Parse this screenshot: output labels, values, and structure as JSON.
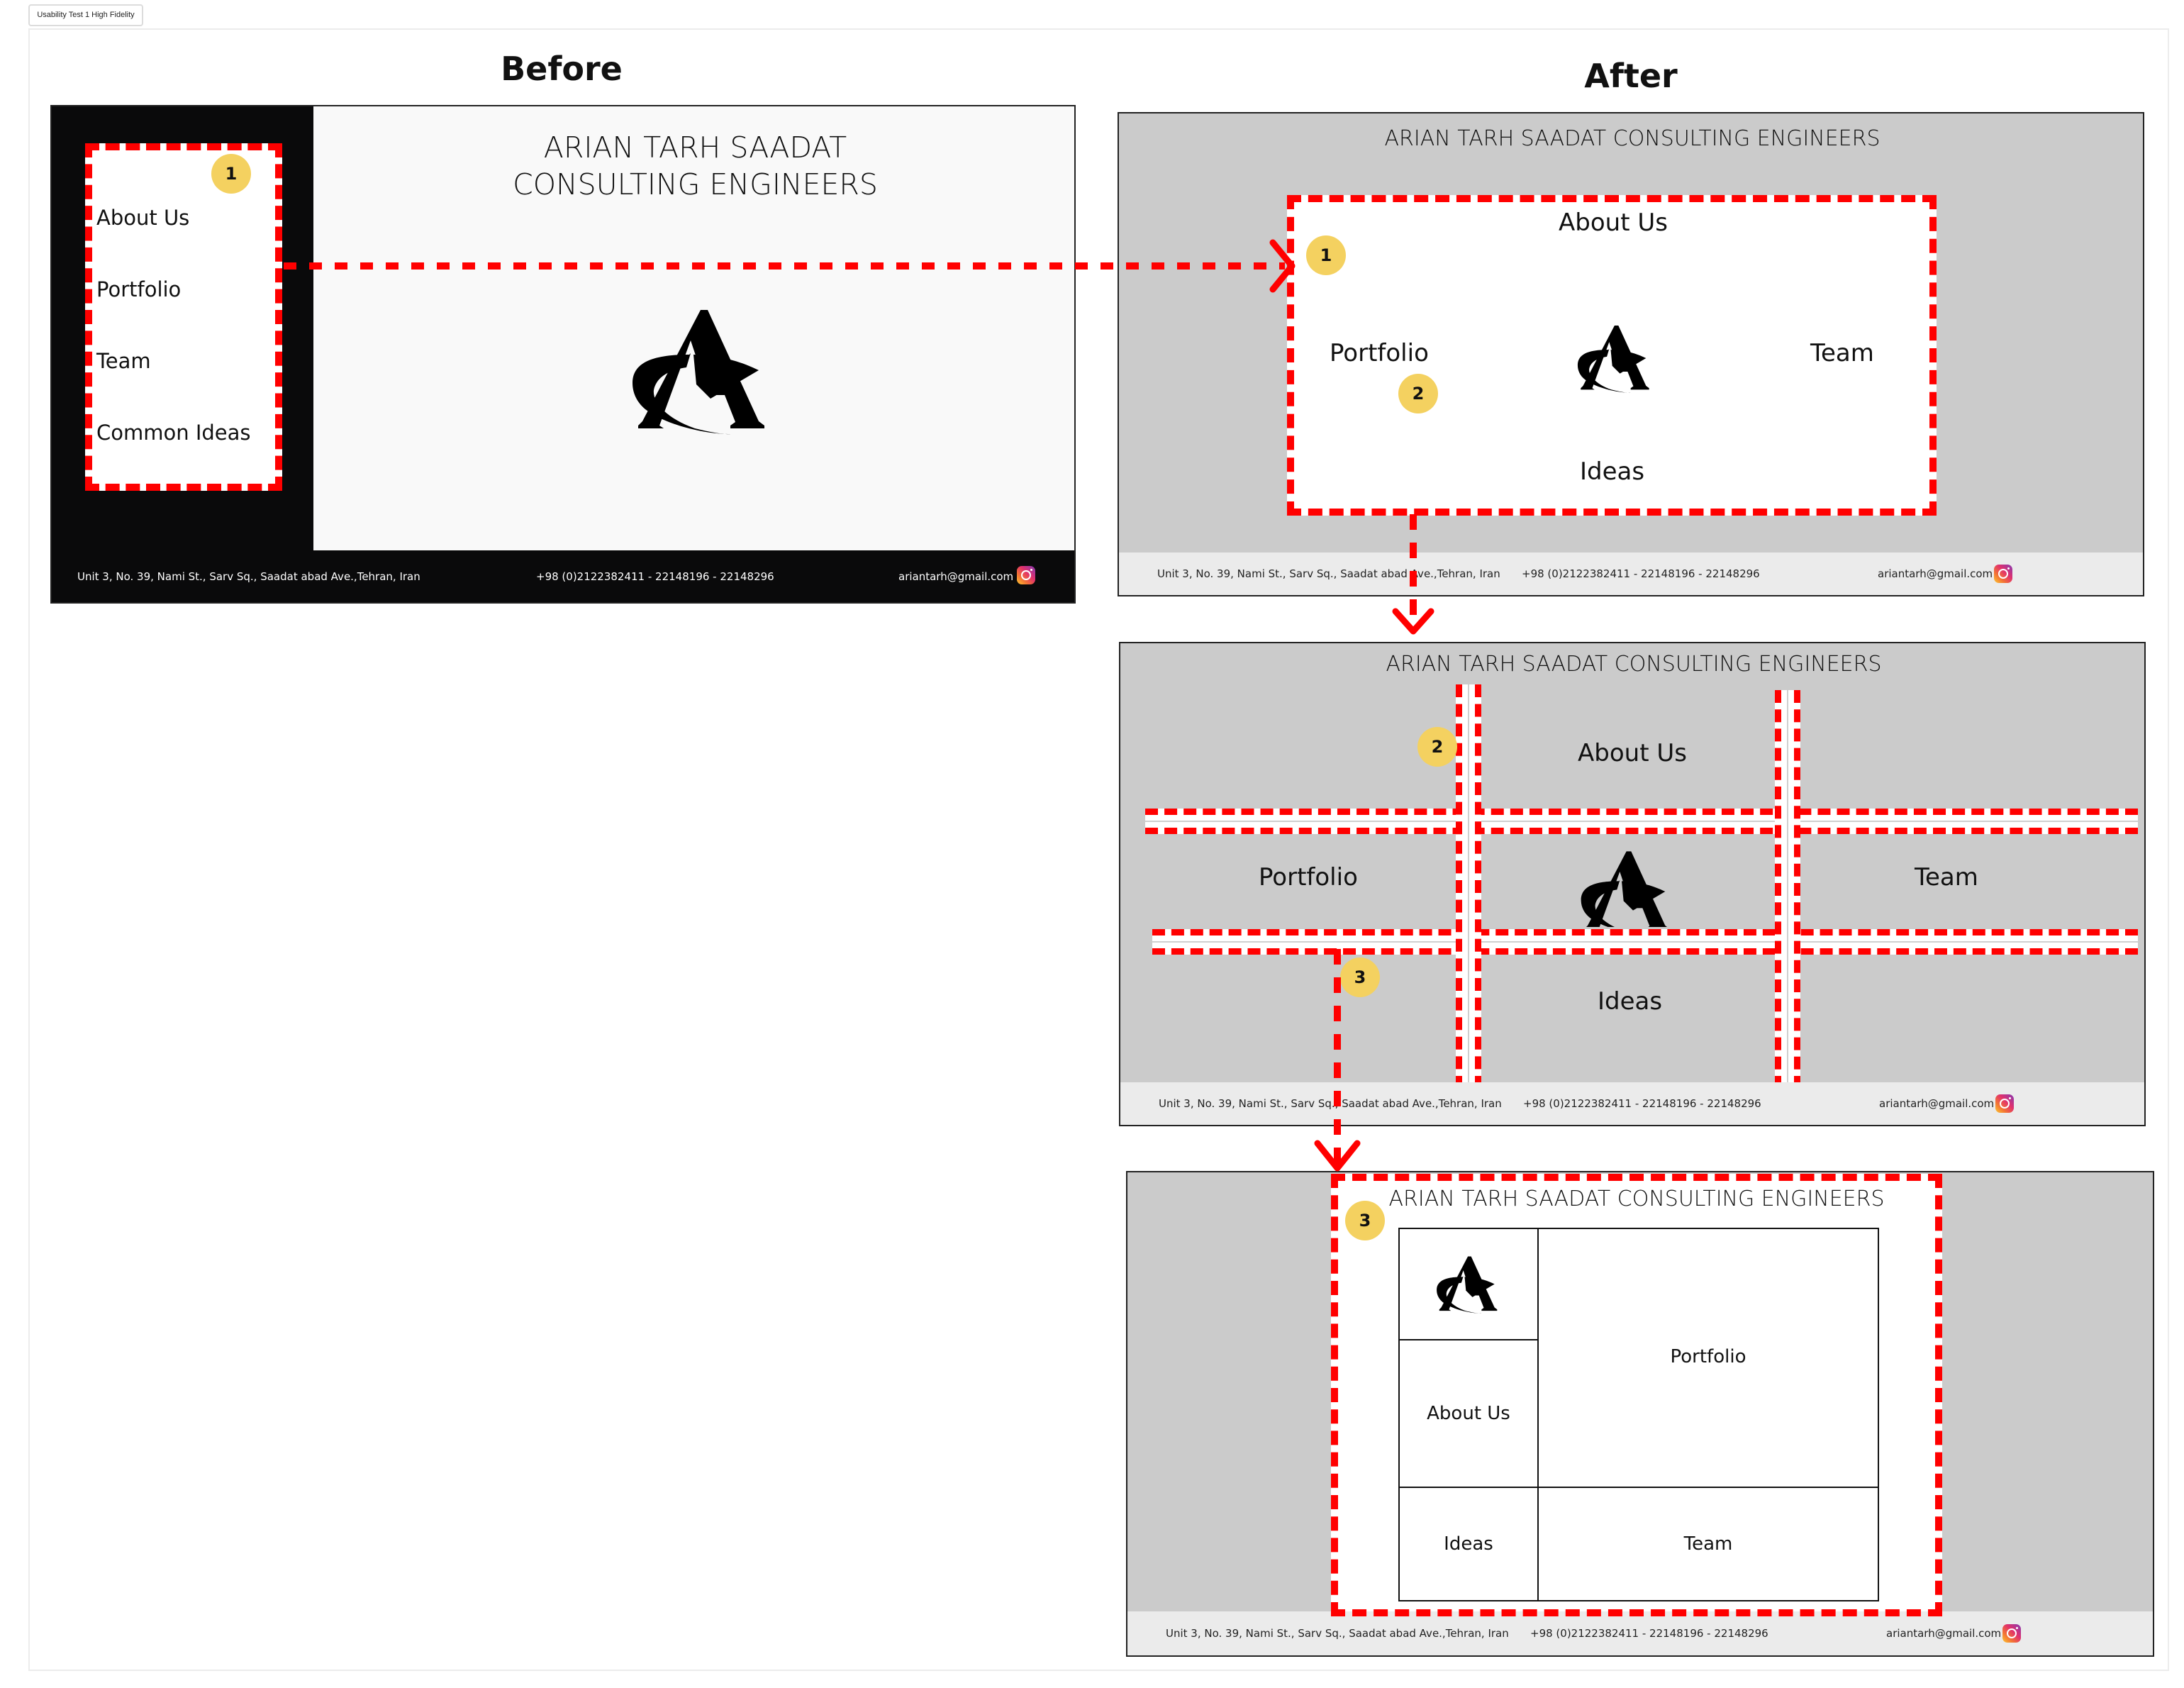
{
  "canvas_label": "Usability Test 1 High Fidelity",
  "headings": {
    "before": "Before",
    "after": "After"
  },
  "colors": {
    "annotation_red": "#ff0000",
    "badge_yellow": "#f4d160",
    "before_sidebar": "#0a0a0b",
    "after_background": "#cbcbcb",
    "after_footer": "#ebebeb"
  },
  "site": {
    "title_line1": "ARIAN TARH SAADAT",
    "title_line2": "CONSULTING ENGINEERS",
    "title_full": "ARIAN TARH SAADAT CONSULTING ENGINEERS",
    "logo": "arian-tarh-logo",
    "footer": {
      "address": "Unit 3, No. 39, Nami St., Sarv Sq., Saadat abad Ave.,Tehran, Iran",
      "phone": "+98 (0)2122382411 - 22148196 - 22148296",
      "email": "ariantarh@gmail.com",
      "social_icon": "instagram-icon"
    }
  },
  "before": {
    "nav": [
      "About Us",
      "Portfolio",
      "Team",
      "Common Ideas"
    ],
    "badge": "1"
  },
  "after1": {
    "nav": {
      "top": "About Us",
      "left": "Portfolio",
      "right": "Team",
      "bottom": "Ideas"
    },
    "badges": [
      "1",
      "2"
    ]
  },
  "after2": {
    "nav": {
      "top": "About Us",
      "left": "Portfolio",
      "right": "Team",
      "bottom": "Ideas"
    },
    "badges": [
      "2",
      "3"
    ]
  },
  "after3": {
    "nav": {
      "about": "About Us",
      "portfolio": "Portfolio",
      "ideas": "Ideas",
      "team": "Team"
    },
    "badge": "3"
  }
}
